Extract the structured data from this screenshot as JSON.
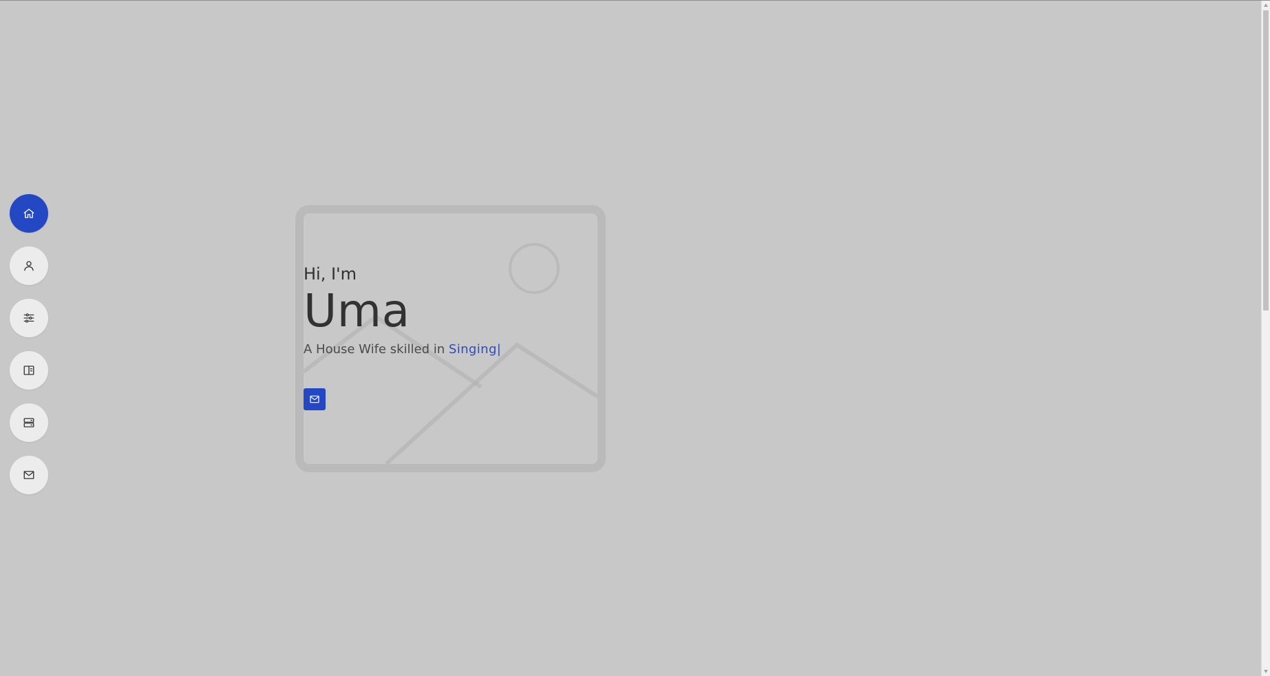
{
  "hero": {
    "greeting": "Hi, I'm",
    "name": "Uma",
    "tagline_prefix": "A House Wife skilled in",
    "skill": "Singing",
    "cursor": "|"
  },
  "sidebar": {
    "items": [
      {
        "icon": "home-icon",
        "active": true
      },
      {
        "icon": "user-icon",
        "active": false
      },
      {
        "icon": "sliders-icon",
        "active": false
      },
      {
        "icon": "book-icon",
        "active": false
      },
      {
        "icon": "server-icon",
        "active": false
      },
      {
        "icon": "mail-icon",
        "active": false
      }
    ]
  },
  "contact_button": {
    "icon": "mail-icon"
  },
  "colors": {
    "background": "#c8c8c8",
    "accent": "#2447c4",
    "nav_button": "#ececec",
    "text": "#2f2f2f"
  }
}
